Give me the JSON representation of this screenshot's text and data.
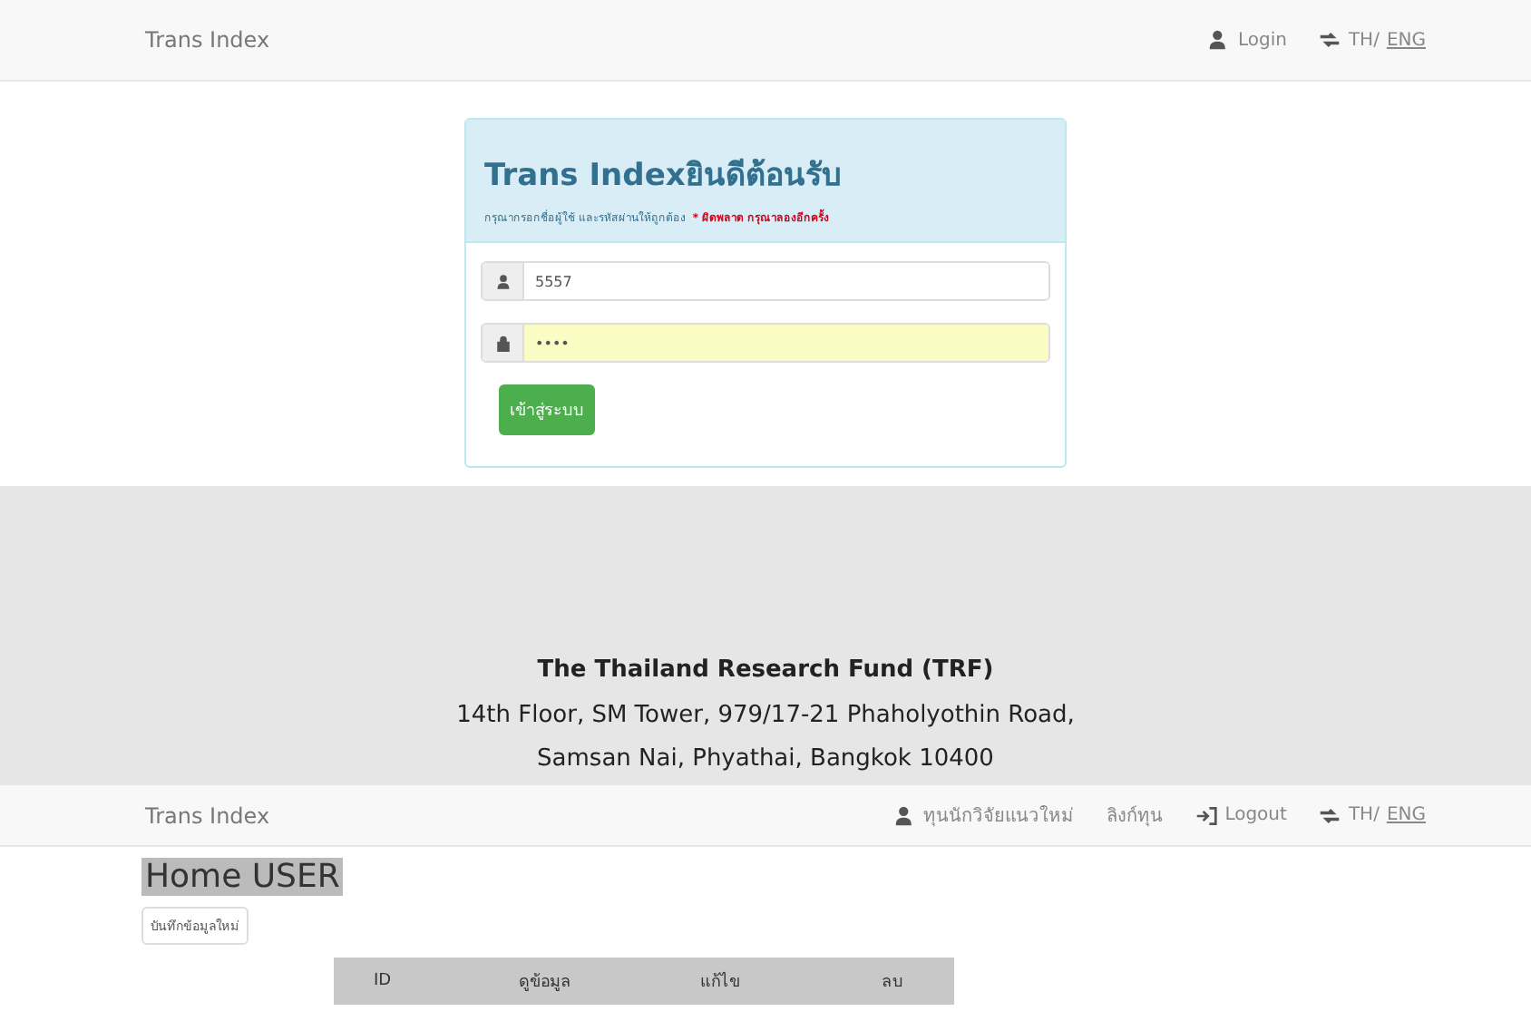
{
  "top_nav": {
    "brand": "Trans Index",
    "links": [
      {
        "kind": "user",
        "label": "Login"
      },
      {
        "kind": "lang",
        "label": "TH/",
        "link": "ENG"
      }
    ]
  },
  "login_panel": {
    "title": "Trans Indexยินดีต้อนรับ",
    "hint": "กรุณากรอกชื่อผู้ใช้ และรหัสผ่านให้ถูกต้อง",
    "error": "* ผิดพลาด กรุณาลองอีกครั้ง",
    "username": {
      "value": "5557"
    },
    "password": {
      "value": "••••"
    },
    "submit": "เข้าสู่ระบบ"
  },
  "footer": {
    "org": "The Thailand Research Fund (TRF)",
    "address": [
      "14th Floor, SM Tower, 979/17-21 Phaholyothin Road,",
      "Samsan Nai, Phyathai, Bangkok 10400"
    ]
  },
  "user_nav": {
    "brand": "Trans Index",
    "links": [
      {
        "kind": "user",
        "label": "ทุนนักวิจัยแนวใหม่"
      },
      {
        "kind": "plain",
        "label": "ลิงก์ทุน"
      },
      {
        "kind": "logout",
        "label": "Logout"
      },
      {
        "kind": "lang",
        "label": "TH/",
        "link": "ENG"
      }
    ]
  },
  "home": {
    "heading": "Home USER",
    "new_button": "บันทึกข้อมูลใหม่",
    "table": {
      "columns": [
        "ID",
        "ดูข้อมูล",
        "แก้ไข",
        "ลบ"
      ]
    }
  }
}
